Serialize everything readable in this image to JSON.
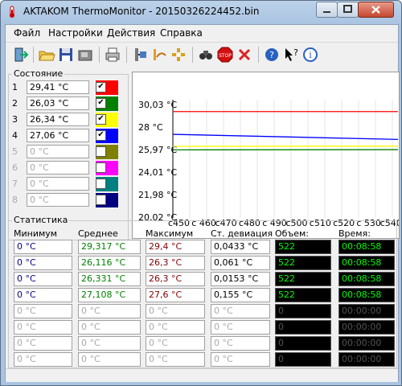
{
  "window": {
    "title": "AKTAKOM ThermoMonitor - 20150326224452.bin"
  },
  "menu": {
    "items": [
      "Файл",
      "Настройки",
      "Действия",
      "Справка"
    ]
  },
  "toolbar": {
    "icons": [
      "exit-icon",
      "open-folder-icon",
      "save-icon",
      "save-as-icon",
      "print-icon",
      "connect-device-icon",
      "record-icon",
      "device-settings-icon",
      "find-icon",
      "stop-icon",
      "delete-icon",
      "help-icon",
      "context-help-icon",
      "info-icon"
    ]
  },
  "state": {
    "title": "Состояние",
    "rows": [
      {
        "num": "1",
        "value": "29,41 °C",
        "checked": true,
        "color": "#ff0000",
        "active": true
      },
      {
        "num": "2",
        "value": "26,03 °C",
        "checked": true,
        "color": "#008000",
        "active": true
      },
      {
        "num": "3",
        "value": "26,34 °C",
        "checked": true,
        "color": "#ffff00",
        "active": true
      },
      {
        "num": "4",
        "value": "27,06 °C",
        "checked": true,
        "color": "#0000ff",
        "active": true
      },
      {
        "num": "5",
        "value": "0 °C",
        "checked": false,
        "color": "#808000",
        "active": false
      },
      {
        "num": "6",
        "value": "0 °C",
        "checked": false,
        "color": "#ff00ff",
        "active": false
      },
      {
        "num": "7",
        "value": "0 °C",
        "checked": false,
        "color": "#008080",
        "active": false
      },
      {
        "num": "8",
        "value": "0 °C",
        "checked": false,
        "color": "#000080",
        "active": false
      }
    ]
  },
  "chart_data": {
    "type": "line",
    "title": "",
    "xlabel": "",
    "ylabel": "",
    "y_ticks": [
      "30,03 °C",
      "28 °C",
      "25,97 °C",
      "24,01 °C",
      "21,98 °C",
      "20,02 °C"
    ],
    "x_ticks": [
      "c450",
      "c 460",
      "c470",
      "c480",
      "c 490",
      "c500",
      "c510",
      "c520",
      "c 530",
      "c540"
    ],
    "ylim": [
      20.02,
      30.03
    ],
    "grid": true,
    "series": [
      {
        "color": "#ff0000",
        "values": [
          29.41,
          29.41
        ]
      },
      {
        "color": "#0000ff",
        "values": [
          27.4,
          26.95
        ]
      },
      {
        "color": "#ffff00",
        "values": [
          26.34,
          26.36
        ]
      },
      {
        "color": "#008000",
        "values": [
          26.03,
          26.05
        ]
      }
    ]
  },
  "stats": {
    "title": "Статистика",
    "headers": [
      "Минимум",
      "Среднее",
      "Максимум",
      "Ст. девиация",
      "Объем:",
      "Время:"
    ],
    "rows": [
      {
        "min": "0 °C",
        "avg": "29,317 °C",
        "max": "29,4 °C",
        "dev": "0,0433 °C",
        "vol": "522",
        "time": "00:08:58",
        "active": true
      },
      {
        "min": "0 °C",
        "avg": "26,116 °C",
        "max": "26,3 °C",
        "dev": "0,061 °C",
        "vol": "522",
        "time": "00:08:58",
        "active": true
      },
      {
        "min": "0 °C",
        "avg": "26,331 °C",
        "max": "26,3 °C",
        "dev": "0,0153 °C",
        "vol": "522",
        "time": "00:08:58",
        "active": true
      },
      {
        "min": "0 °C",
        "avg": "27,108 °C",
        "max": "27,6 °C",
        "dev": "0,155 °C",
        "vol": "522",
        "time": "00:08:58",
        "active": true
      },
      {
        "min": "0 °C",
        "avg": "0 °C",
        "max": "0 °C",
        "dev": "0 °C",
        "vol": "0",
        "time": "00:00:00",
        "active": false
      },
      {
        "min": "0 °C",
        "avg": "0 °C",
        "max": "0 °C",
        "dev": "0 °C",
        "vol": "0",
        "time": "00:00:00",
        "active": false
      },
      {
        "min": "0 °C",
        "avg": "0 °C",
        "max": "0 °C",
        "dev": "0 °C",
        "vol": "0",
        "time": "00:00:00",
        "active": false
      },
      {
        "min": "0 °C",
        "avg": "0 °C",
        "max": "0 °C",
        "dev": "0 °C",
        "vol": "0",
        "time": "00:00:00",
        "active": false
      }
    ],
    "colors": {
      "min_active": "#000080",
      "avg_active": "#008000",
      "max_active": "#800000",
      "dim": "#a8a8a8",
      "vol_active": "#00ff00",
      "vol_dim": "#555555"
    }
  }
}
